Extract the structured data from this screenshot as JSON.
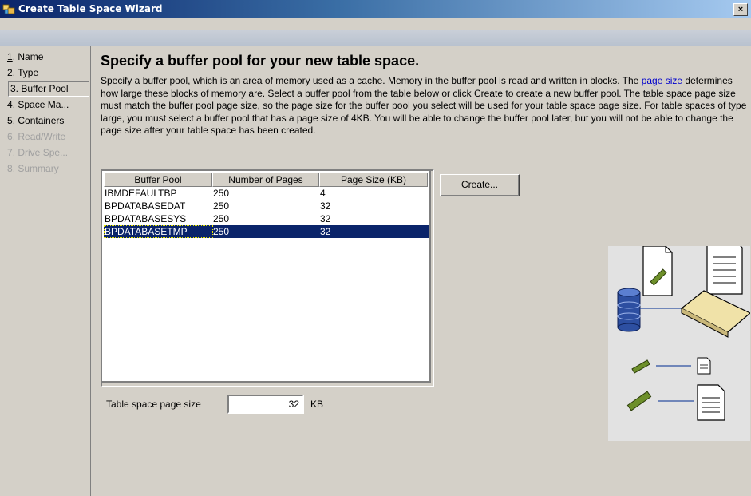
{
  "window": {
    "title": "Create Table Space Wizard",
    "close_label": "×"
  },
  "nav": {
    "items": [
      {
        "num": "1",
        "label": ". Name",
        "state": "normal"
      },
      {
        "num": "2",
        "label": ". Type",
        "state": "normal"
      },
      {
        "num": "",
        "label": "3. Buffer Pool",
        "state": "active"
      },
      {
        "num": "4",
        "label": ". Space Ma...",
        "state": "normal"
      },
      {
        "num": "5",
        "label": ". Containers",
        "state": "normal"
      },
      {
        "num": "6",
        "label": ". Read/Write",
        "state": "disabled"
      },
      {
        "num": "7",
        "label": ". Drive Spe...",
        "state": "disabled"
      },
      {
        "num": "8",
        "label": ". Summary",
        "state": "disabled"
      }
    ]
  },
  "main": {
    "heading": "Specify a buffer pool for your new table space.",
    "desc_part1": "Specify a buffer pool, which is an area of memory used as a cache.  Memory in the buffer pool is read and written in blocks. The ",
    "desc_link": "page size",
    "desc_part2": " determines how large these blocks of memory are.  Select a buffer pool from the table below or click Create to create a new buffer pool.  The table space page size must match the buffer pool page size, so the page size for the buffer pool you select will be used for your table space page size.  For table spaces of type large, you must select a buffer pool that has a page size of 4KB.  You will be able to change the buffer pool later, but you will not be able to change the page size after your table space has been created."
  },
  "table": {
    "columns": [
      "Buffer Pool",
      "Number of Pages",
      "Page Size (KB)"
    ],
    "rows": [
      [
        "IBMDEFAULTBP",
        "250",
        "4"
      ],
      [
        "BPDATABASEDAT",
        "250",
        "32"
      ],
      [
        "BPDATABASESYS",
        "250",
        "32"
      ],
      [
        "BPDATABASETMP",
        "250",
        "32"
      ]
    ],
    "selected_row": 3
  },
  "create_button": {
    "label": "Create...",
    "mnemonic": "C"
  },
  "page_size": {
    "label": "Table space page size",
    "value": "32",
    "unit": "KB"
  },
  "colors": {
    "selection": "#0a246a",
    "background": "#d4d0c8",
    "link": "#0000cc"
  },
  "icons": [
    "database-icon",
    "memory-chip-icon",
    "document-icon",
    "tray-icon"
  ]
}
